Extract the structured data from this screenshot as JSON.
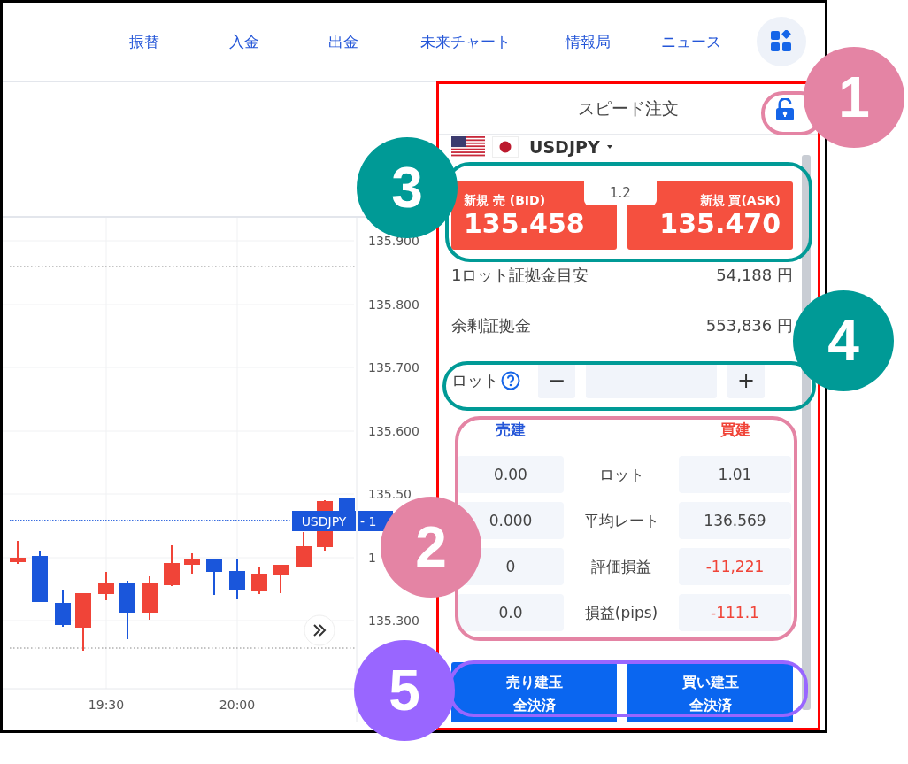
{
  "nav": {
    "items": [
      "振替",
      "入金",
      "出金",
      "未来チャート",
      "情報局",
      "ニュース"
    ]
  },
  "chart": {
    "y_axis_labels": [
      "135.900",
      "135.800",
      "135.700",
      "135.600",
      "135.50",
      "1",
      "135.300"
    ],
    "x_axis_labels": [
      "19:30",
      "20:00"
    ],
    "price_tag": {
      "symbol": "USDJPY",
      "value": "- 1"
    }
  },
  "order_panel": {
    "title": "スピード注文",
    "pair": "USDJPY",
    "quotes": [
      {
        "kind": "sell",
        "label": "新規 売 (BID)",
        "price": "135.458"
      },
      {
        "kind": "buy",
        "label": "新規 買(ASK)",
        "price": "135.470"
      }
    ],
    "spread": "1.2",
    "info": [
      {
        "label": "1ロット証拠金目安",
        "value": "54,188 円"
      },
      {
        "label": "余剰証拠金",
        "value": "553,836 円"
      }
    ],
    "lot": {
      "label": "ロット",
      "minus": "−",
      "plus": "+"
    },
    "positions": {
      "columns": [
        {
          "kind": "sell",
          "label": "売建"
        },
        {
          "kind": "buy",
          "label": "買建"
        }
      ],
      "rows": [
        {
          "label": "ロット",
          "sell": "0.00",
          "buy": "1.01",
          "buy_negative": false
        },
        {
          "label": "平均レート",
          "sell": "0.000",
          "buy": "136.569",
          "buy_negative": false
        },
        {
          "label": "評価損益",
          "sell": "0",
          "buy": "-11,221",
          "buy_negative": true
        },
        {
          "label": "損益(pips)",
          "sell": "0.0",
          "buy": "-111.1",
          "buy_negative": true
        }
      ]
    },
    "close_buttons": [
      {
        "lines": [
          "売り建玉",
          "全決済"
        ]
      },
      {
        "lines": [
          "買い建玉",
          "全決済"
        ]
      }
    ]
  },
  "annotations": [
    {
      "number": "1",
      "color": "#e484a4"
    },
    {
      "number": "2",
      "color": "#e484a4"
    },
    {
      "number": "3",
      "color": "#009a96"
    },
    {
      "number": "4",
      "color": "#009a96"
    },
    {
      "number": "5",
      "color": "#9966ff"
    }
  ]
}
